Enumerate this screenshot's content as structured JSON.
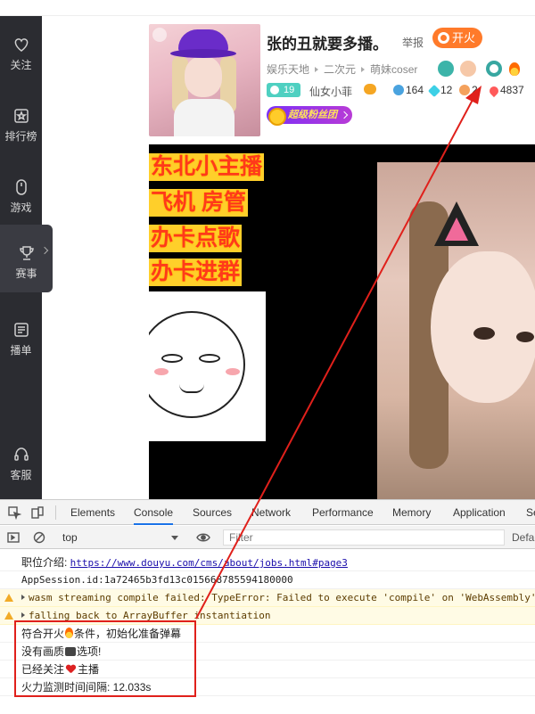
{
  "sidebar": {
    "items": [
      {
        "label": "关注",
        "icon": "heart-icon"
      },
      {
        "label": "排行榜",
        "icon": "rank-icon"
      },
      {
        "label": "游戏",
        "icon": "mouse-icon"
      },
      {
        "label": "赛事",
        "icon": "trophy-icon"
      },
      {
        "label": "播单",
        "icon": "playlist-icon"
      },
      {
        "label": "客服",
        "icon": "headset-icon"
      }
    ]
  },
  "room": {
    "title": "张的丑就要多播。",
    "report_label": "举报",
    "fire_button": "开火",
    "breadcrumbs": [
      "娱乐天地",
      "二次元",
      "萌妹coser"
    ],
    "level": "19",
    "streamer": "仙女小菲",
    "stats": {
      "globe": "164",
      "gem": "12",
      "face": "2",
      "heat": "4837"
    },
    "fans_badge": "超级粉丝团"
  },
  "video": {
    "overlay_lines": [
      "东北小主播",
      "飞机  房管",
      "办卡点歌",
      "办卡进群"
    ]
  },
  "devtools": {
    "tabs": [
      "Elements",
      "Console",
      "Sources",
      "Network",
      "Performance",
      "Memory",
      "Application",
      "Se"
    ],
    "active_tab": "Console",
    "context": "top",
    "filter_placeholder": "Filter",
    "levels": "Defa",
    "log": {
      "l0_prefix": "职位介绍: ",
      "l0_link": "https://www.douyu.com/cms/about/jobs.html#page3",
      "l1": "AppSession.id:1a72465b3fd13c015668785594180000",
      "l2": "wasm streaming compile failed: TypeError: Failed to execute 'compile' on 'WebAssembly'",
      "l3": "falling back to ArrayBuffer instantiation",
      "l4_a": "符合开火",
      "l4_b": "条件，初始化准备弹幕",
      "l5_a": "没有画质",
      "l5_b": "选项!",
      "l6_a": "已经关注",
      "l6_b": "主播",
      "l7": "火力监测时间间隔: 12.033s"
    }
  },
  "colors": {
    "annotation": "#e0201b",
    "accent": "#1a73e8",
    "fire": "#ff7a2a"
  }
}
